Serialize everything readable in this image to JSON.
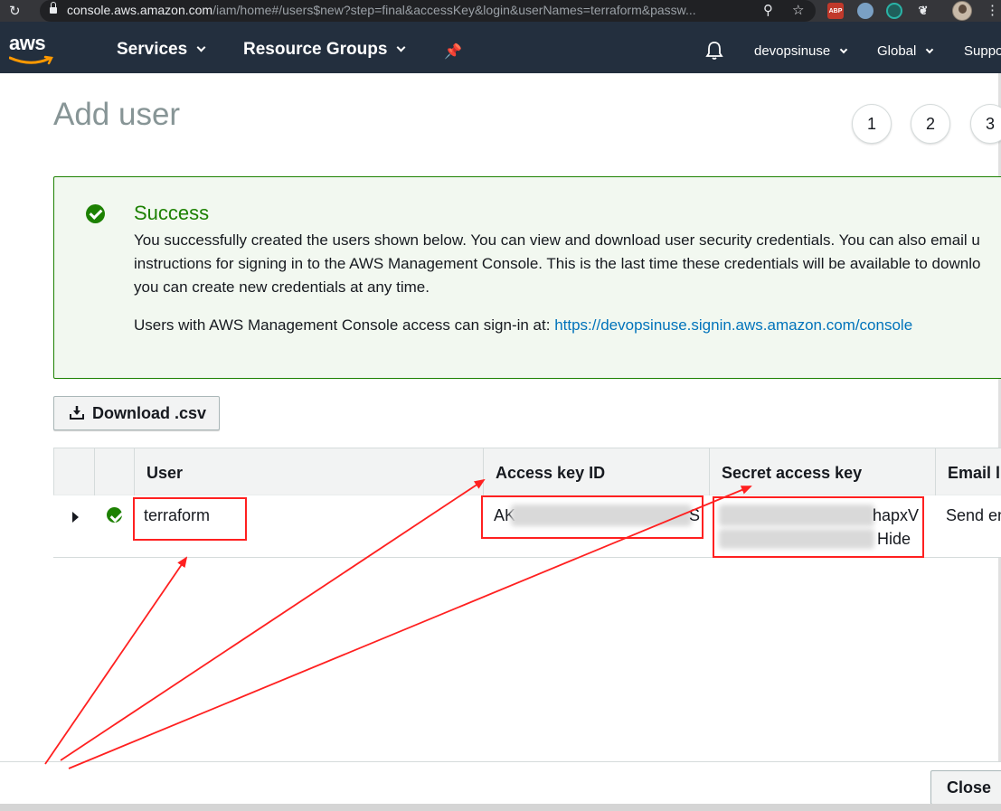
{
  "browser": {
    "url_host": "console.aws.amazon.com",
    "url_path": "/iam/home#/users$new?step=final&accessKey&login&userNames=terraform&passw...",
    "extensions": [
      "ABP"
    ]
  },
  "nav": {
    "logo": "aws",
    "services": "Services",
    "resource_groups": "Resource Groups",
    "account": "devopsinuse",
    "region": "Global",
    "support": "Suppo"
  },
  "page": {
    "title": "Add user",
    "steps": [
      "1",
      "2",
      "3"
    ]
  },
  "success": {
    "title": "Success",
    "line1": "You successfully created the users shown below. You can view and download user security credentials. You can also email u",
    "line2": "instructions for signing in to the AWS Management Console. This is the last time these credentials will be available to downlo",
    "line3": "you can create new credentials at any time.",
    "signin_prefix": "Users with AWS Management Console access can sign-in at:",
    "signin_url": "https://devopsinuse.signin.aws.amazon.com/console"
  },
  "download_button": "Download .csv",
  "table": {
    "headers": [
      "User",
      "Access key ID",
      "Secret access key",
      "Email l"
    ],
    "row": {
      "user": "terraform",
      "access_key_prefix": "AK",
      "access_key_suffix": "S",
      "secret_suffix": "hapxV",
      "hide_link": "Hide",
      "email_link": "Send en"
    }
  },
  "footer": {
    "close": "Close"
  },
  "colors": {
    "aws_nav": "#232f3e",
    "success_green": "#1d8102",
    "link_blue": "#0073bb",
    "annotation_red": "#ff2020",
    "aws_orange": "#ff9900"
  }
}
